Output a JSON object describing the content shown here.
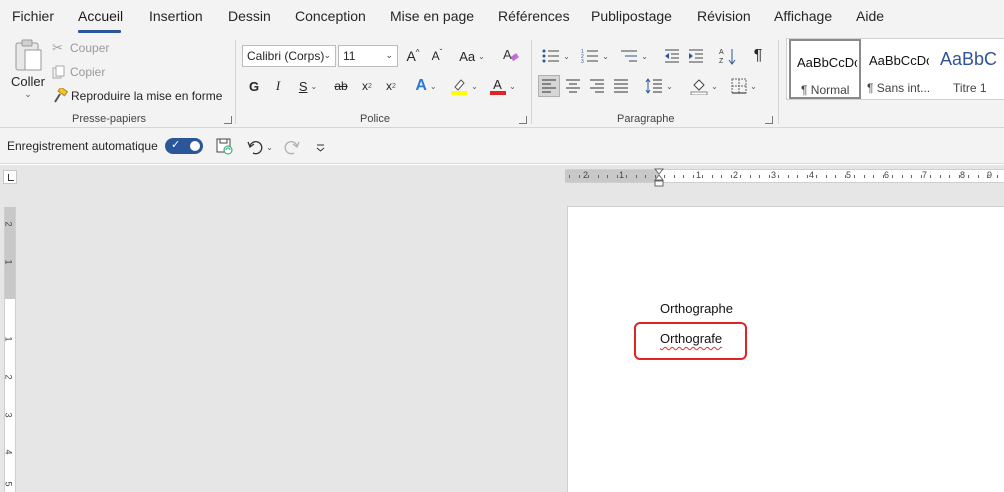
{
  "menu": {
    "tabs": [
      "Fichier",
      "Accueil",
      "Insertion",
      "Dessin",
      "Conception",
      "Mise en page",
      "Références",
      "Publipostage",
      "Révision",
      "Affichage",
      "Aide"
    ],
    "active_tab": "Accueil"
  },
  "ribbon": {
    "clipboard": {
      "paste_label": "Coller",
      "cut_label": "Couper",
      "copy_label": "Copier",
      "format_painter_label": "Reproduire la mise en forme",
      "group_label": "Presse-papiers"
    },
    "font": {
      "font_name": "Calibri (Corps)",
      "font_size": "11",
      "grow_label": "A",
      "shrink_label": "A",
      "case_label": "Aa",
      "bold_label": "G",
      "italic_label": "I",
      "underline_label": "S",
      "strike_label": "ab",
      "subscript_label": "x",
      "superscript_label": "x",
      "effects_label": "A",
      "font_color_label": "A",
      "group_label": "Police"
    },
    "paragraph": {
      "pilcrow_label": "¶",
      "group_label": "Paragraphe"
    },
    "styles": {
      "items": [
        {
          "sample": "AaBbCcDc",
          "name": "¶ Normal"
        },
        {
          "sample": "AaBbCcDc",
          "name": "¶ Sans int..."
        },
        {
          "sample": "AaBbC",
          "name": "Titre 1"
        }
      ]
    }
  },
  "qat": {
    "autosave_label": "Enregistrement automatique"
  },
  "ruler": {
    "h_numbers": [
      "2",
      "1",
      "1",
      "2",
      "3",
      "4",
      "5",
      "6",
      "7",
      "8",
      "9"
    ],
    "v_numbers": [
      "2",
      "1",
      "1",
      "2",
      "3",
      "4",
      "5"
    ]
  },
  "document": {
    "line1": "Orthographe",
    "line2": "Orthografe"
  },
  "colors": {
    "accent": "#2b579a",
    "highlight_yellow": "#ffff00",
    "font_color_red": "#e02424",
    "annotation_red": "#e02424",
    "spellcheck_red": "#e03030"
  },
  "icons": [
    "scissors-icon",
    "copy-icon",
    "paintbrush-icon",
    "paste-icon",
    "save-icon",
    "undo-icon",
    "redo-icon",
    "customize-icon",
    "bullets-icon",
    "numbering-icon",
    "multilevel-icon",
    "decrease-indent-icon",
    "increase-indent-icon",
    "sort-icon",
    "pilcrow-icon",
    "align-left-icon",
    "align-center-icon",
    "align-right-icon",
    "justify-icon",
    "line-spacing-icon",
    "shading-icon",
    "borders-icon",
    "clear-format-icon",
    "highlighter-icon"
  ]
}
